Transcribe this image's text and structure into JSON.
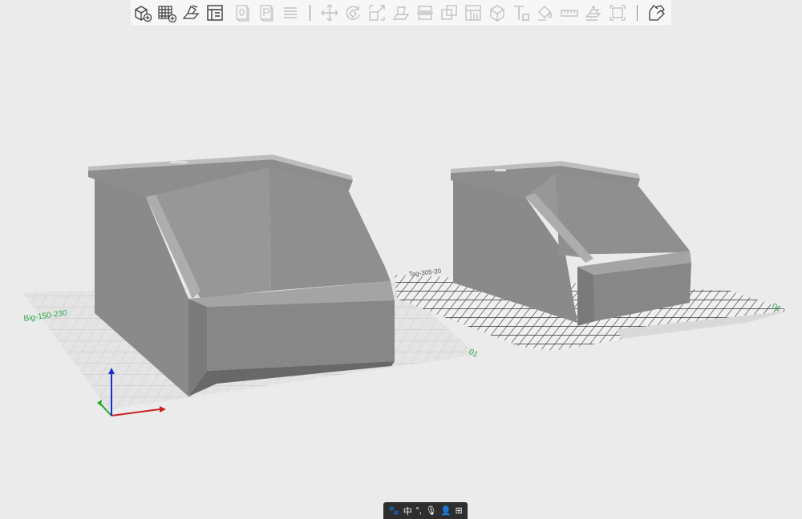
{
  "toolbar": {
    "buttons": [
      {
        "name": "add-object-icon",
        "enabled": true
      },
      {
        "name": "add-plate-icon",
        "enabled": true
      },
      {
        "name": "auto-arrange-icon",
        "enabled": true
      },
      {
        "name": "layout-icon",
        "enabled": true
      },
      {
        "name": "copy-icon",
        "enabled": false
      },
      {
        "name": "paste-icon",
        "enabled": false
      },
      {
        "name": "layers-icon",
        "enabled": false
      },
      {
        "name": "move-icon",
        "enabled": false
      },
      {
        "name": "rotate-icon",
        "enabled": false
      },
      {
        "name": "scale-icon",
        "enabled": false
      },
      {
        "name": "lay-on-face-icon",
        "enabled": false
      },
      {
        "name": "cut-icon",
        "enabled": false
      },
      {
        "name": "boolean-icon",
        "enabled": false
      },
      {
        "name": "support-paint-icon",
        "enabled": false
      },
      {
        "name": "seam-paint-icon",
        "enabled": false
      },
      {
        "name": "text-icon",
        "enabled": false
      },
      {
        "name": "color-paint-icon",
        "enabled": false
      },
      {
        "name": "measure-icon",
        "enabled": false
      },
      {
        "name": "assembly-icon",
        "enabled": false
      },
      {
        "name": "fit-view-icon",
        "enabled": false
      },
      {
        "name": "split-to-parts-icon",
        "enabled": true
      }
    ]
  },
  "plates": {
    "left_label": "Big-150-230",
    "left_number": "01",
    "right_label": "Tag-305-30",
    "right_number": "01"
  },
  "ime": {
    "paw": "🐾",
    "lang": "中",
    "punct": "°,",
    "mic": "🎙",
    "user": "👤",
    "grid": "⊞"
  },
  "colors": {
    "background": "#ebebeb",
    "part_light": "#9a9a9a",
    "part_dark": "#6e6e6e",
    "axis_x": "#cc2222",
    "axis_y": "#22aa22",
    "axis_z": "#1a2fd0",
    "plate_label": "#2aa84a"
  }
}
